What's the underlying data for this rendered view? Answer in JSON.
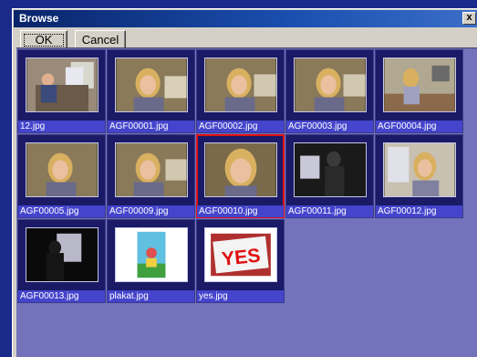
{
  "window": {
    "title": "Browse",
    "close_glyph": "x"
  },
  "toolbar": {
    "ok_label": "OK",
    "cancel_label": "Cancel"
  },
  "files": [
    {
      "name": "12.jpg",
      "icon": "photo-computer-child"
    },
    {
      "name": "AGF00001.jpg",
      "icon": "photo-girl"
    },
    {
      "name": "AGF00002.jpg",
      "icon": "photo-girl"
    },
    {
      "name": "AGF00003.jpg",
      "icon": "photo-girl"
    },
    {
      "name": "AGF00004.jpg",
      "icon": "photo-girl-room"
    },
    {
      "name": "AGF00005.jpg",
      "icon": "photo-girl"
    },
    {
      "name": "AGF00009.jpg",
      "icon": "photo-girl"
    },
    {
      "name": "AGF00010.jpg",
      "icon": "photo-girl-closeup",
      "selected": true
    },
    {
      "name": "AGF00011.jpg",
      "icon": "photo-silhouette-window"
    },
    {
      "name": "AGF00012.jpg",
      "icon": "photo-girl-window"
    },
    {
      "name": "AGF00013.jpg",
      "icon": "photo-silhouette-dark"
    },
    {
      "name": "plakat.jpg",
      "icon": "poster-image"
    },
    {
      "name": "yes.jpg",
      "icon": "yes-sign-image"
    }
  ],
  "colors": {
    "selection": "#e01010",
    "caption_bg": "#4444cc",
    "grid_bg": "#7373bb"
  }
}
